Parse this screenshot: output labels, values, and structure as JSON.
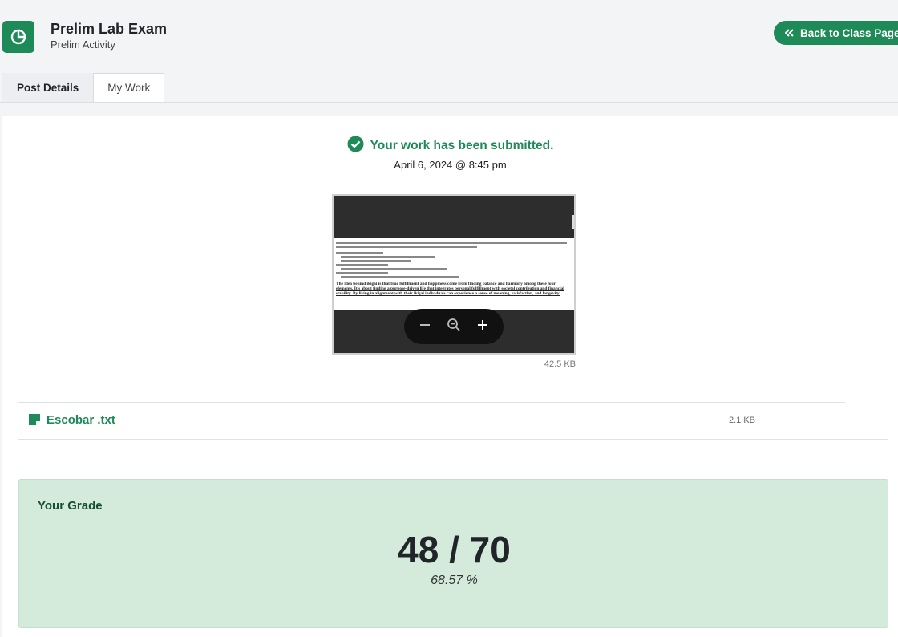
{
  "header": {
    "title": "Prelim Lab Exam",
    "subtitle": "Prelim Activity",
    "back_label": "Back to Class Page"
  },
  "tabs": [
    {
      "label": "Post Details",
      "active": false
    },
    {
      "label": "My Work",
      "active": true
    }
  ],
  "submission": {
    "status": "Your work has been submitted.",
    "date": "April 6, 2024 @ 8:45 pm"
  },
  "preview": {
    "size": "42.5 KB",
    "excerpt": "The idea behind ikigai is that true fulfillment and happiness come from finding balance and harmony among these four elements. It's about finding a purpose-driven life that integrates personal fulfillment with societal contribution and financial stability. By living in alignment with their ikigai individuals can experience a sense of meaning, satisfaction, and longevity."
  },
  "file": {
    "name": "Escobar .txt",
    "size": "2.1 KB"
  },
  "grade": {
    "label": "Your Grade",
    "score": "48 / 70",
    "percent": "68.57 %"
  },
  "colors": {
    "accent": "#1e8a57",
    "grade_bg": "#d4ebdc"
  }
}
